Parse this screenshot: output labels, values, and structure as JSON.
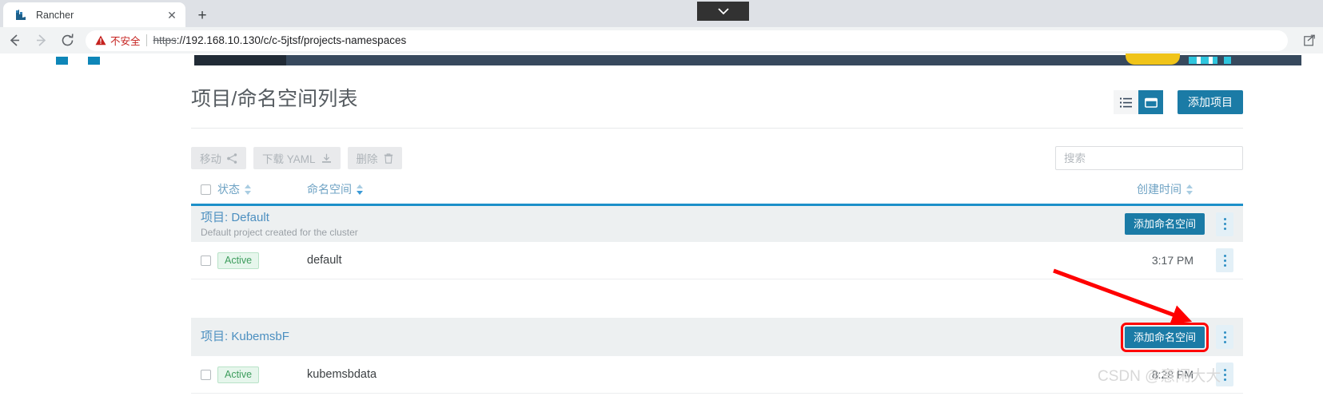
{
  "browser": {
    "tab_title": "Rancher",
    "tab_close_glyph": "✕",
    "newtab_glyph": "+",
    "security_label": "不安全",
    "url_scheme": "https",
    "url_rest": "://192.168.10.130/c/c-5jtsf/projects-namespaces"
  },
  "header": {
    "title": "项目/命名空间列表",
    "add_project_label": "添加项目"
  },
  "toolbar": {
    "move_label": "移动",
    "download_yaml_label": "下载 YAML",
    "delete_label": "删除",
    "search_placeholder": "搜索"
  },
  "table": {
    "columns": {
      "state": "状态",
      "namespace": "命名空间",
      "created": "创建时间"
    },
    "groups": [
      {
        "prefix": "项目:",
        "name": "Default",
        "description": "Default project created for the cluster",
        "add_namespace_label": "添加命名空间",
        "rows": [
          {
            "state": "Active",
            "namespace": "default",
            "created": "3:17 PM"
          }
        ]
      },
      {
        "prefix": "项目:",
        "name": "KubemsbF",
        "description": "",
        "add_namespace_label": "添加命名空间",
        "rows": [
          {
            "state": "Active",
            "namespace": "kubemsbdata",
            "created": "8:28 PM"
          }
        ]
      }
    ]
  },
  "annotations": {
    "watermark": "CSDN @意闲大大",
    "arrow_color": "#ff0000",
    "highlight_color": "#ff0000"
  },
  "colors": {
    "accent": "#1b7ba6",
    "link": "#4c8fc0",
    "group_bg": "#edf0f1",
    "badge_text": "#3d9d5d",
    "warning": "#c5221f"
  }
}
